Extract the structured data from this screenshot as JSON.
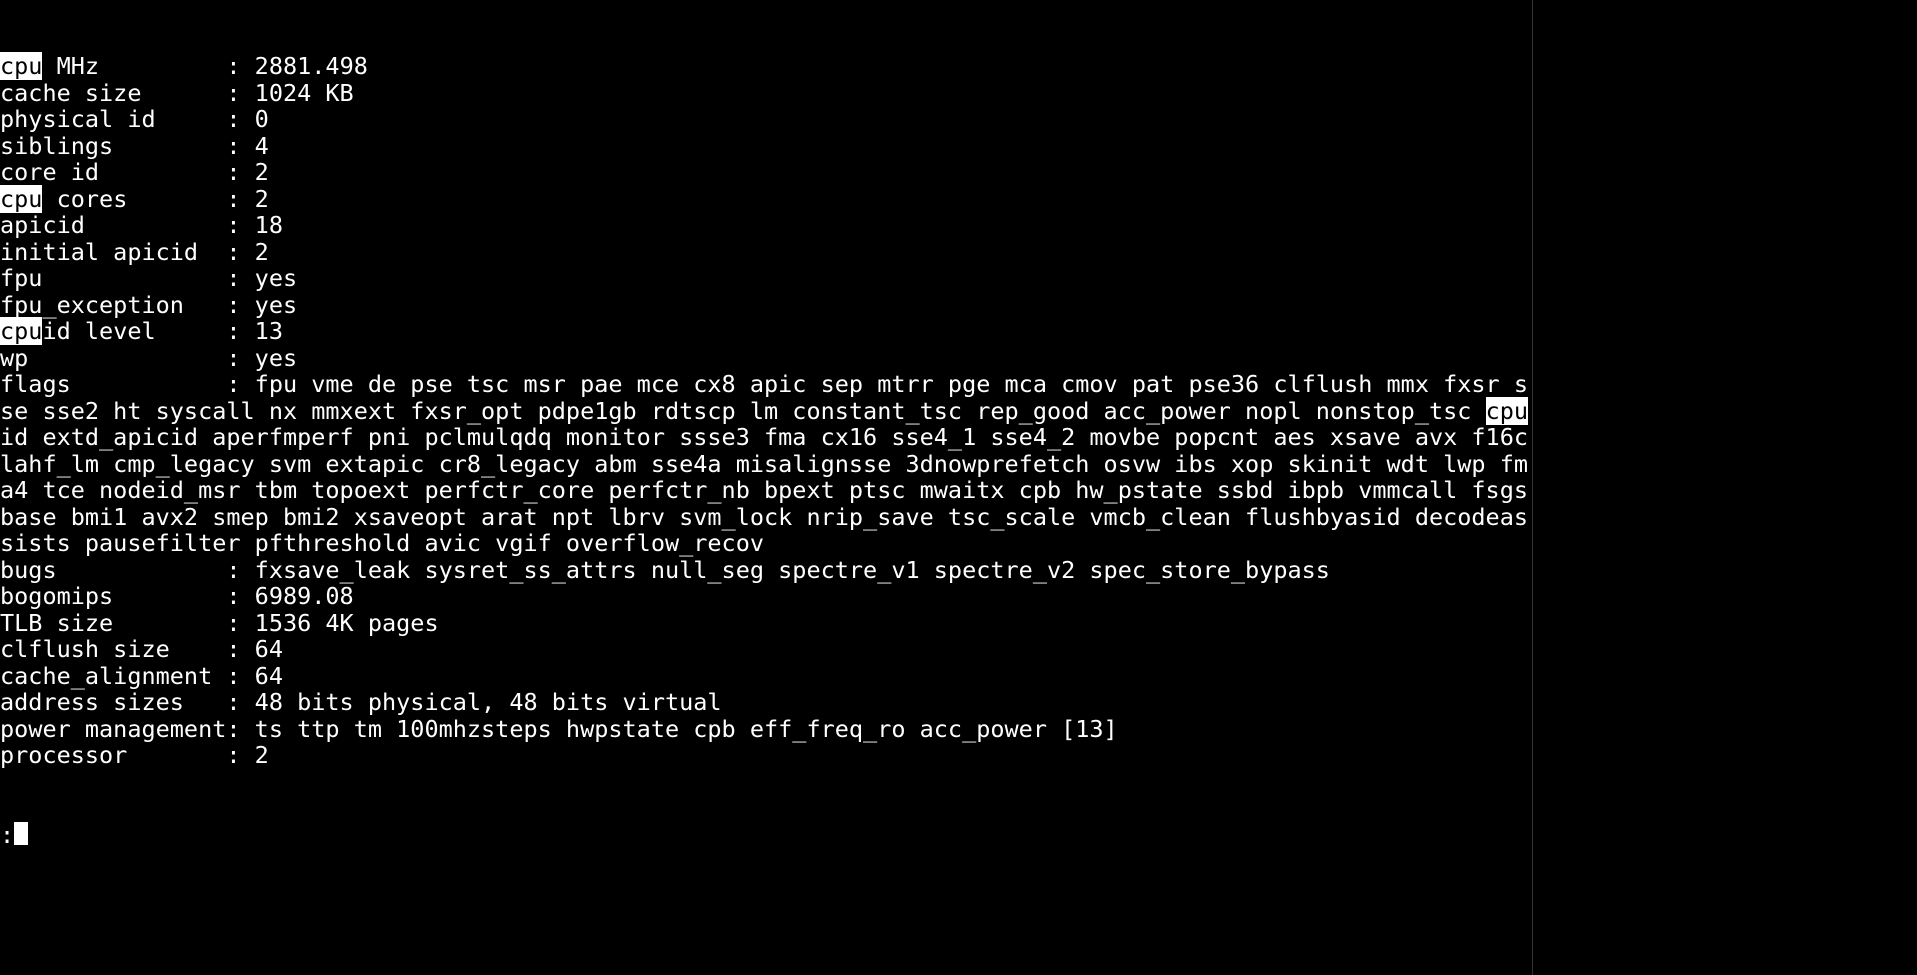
{
  "highlight_term": "cpu",
  "entries": [
    {
      "label_pre_hl": "",
      "label_hl": "cpu",
      "label_post_hl": " MHz",
      "value": "2881.498"
    },
    {
      "label_pre_hl": "cache size",
      "label_hl": "",
      "label_post_hl": "",
      "value": "1024 KB"
    },
    {
      "label_pre_hl": "physical id",
      "label_hl": "",
      "label_post_hl": "",
      "value": "0"
    },
    {
      "label_pre_hl": "siblings",
      "label_hl": "",
      "label_post_hl": "",
      "value": "4"
    },
    {
      "label_pre_hl": "core id",
      "label_hl": "",
      "label_post_hl": "",
      "value": "2"
    },
    {
      "label_pre_hl": "",
      "label_hl": "cpu",
      "label_post_hl": " cores",
      "value": "2"
    },
    {
      "label_pre_hl": "apicid",
      "label_hl": "",
      "label_post_hl": "",
      "value": "18"
    },
    {
      "label_pre_hl": "initial apicid",
      "label_hl": "",
      "label_post_hl": "",
      "value": "2"
    },
    {
      "label_pre_hl": "fpu",
      "label_hl": "",
      "label_post_hl": "",
      "value": "yes"
    },
    {
      "label_pre_hl": "fpu_exception",
      "label_hl": "",
      "label_post_hl": "",
      "value": "yes"
    },
    {
      "label_pre_hl": "",
      "label_hl": "cpu",
      "label_post_hl": "id level",
      "value": "13"
    },
    {
      "label_pre_hl": "wp",
      "label_hl": "",
      "label_post_hl": "",
      "value": "yes"
    }
  ],
  "flags_label": "flags",
  "flags_before_hl": "fpu vme de pse tsc msr pae mce cx8 apic sep mtrr pge mca cmov pat pse36 clflush mmx fxsr sse sse2 ht syscall nx mmxext fxsr_opt pdpe1gb rdtscp lm constant_tsc rep_good acc_power nopl nonstop_tsc ",
  "flags_hl": "cpu",
  "flags_after_hl": "id extd_apicid aperfmperf pni pclmulqdq monitor ssse3 fma cx16 sse4_1 sse4_2 movbe popcnt aes xsave avx f16c lahf_lm cmp_legacy svm extapic cr8_legacy abm sse4a misalignsse 3dnowprefetch osvw ibs xop skinit wdt lwp fma4 tce nodeid_msr tbm topoext perfctr_core perfctr_nb bpext ptsc mwaitx cpb hw_pstate ssbd ibpb vmmcall fsgsbase bmi1 avx2 smep bmi2 xsaveopt arat npt lbrv svm_lock nrip_save tsc_scale vmcb_clean flushbyasid decodeassists pausefilter pfthreshold avic vgif overflow_recov",
  "post_flags_entries": [
    {
      "label": "bugs",
      "value": "fxsave_leak sysret_ss_attrs null_seg spectre_v1 spectre_v2 spec_store_bypass"
    },
    {
      "label": "bogomips",
      "value": "6989.08"
    },
    {
      "label": "TLB size",
      "value": "1536 4K pages"
    },
    {
      "label": "clflush size",
      "value": "64"
    },
    {
      "label": "cache_alignment",
      "value": "64"
    },
    {
      "label": "address sizes",
      "value": "48 bits physical, 48 bits virtual"
    }
  ],
  "power_mgmt_label": "power management",
  "power_mgmt_value": "ts ttp tm 100mhzsteps hwpstate cpb eff_freq_ro acc_power [13]",
  "next_processor_label": "processor",
  "next_processor_value": "2",
  "prompt": ":"
}
